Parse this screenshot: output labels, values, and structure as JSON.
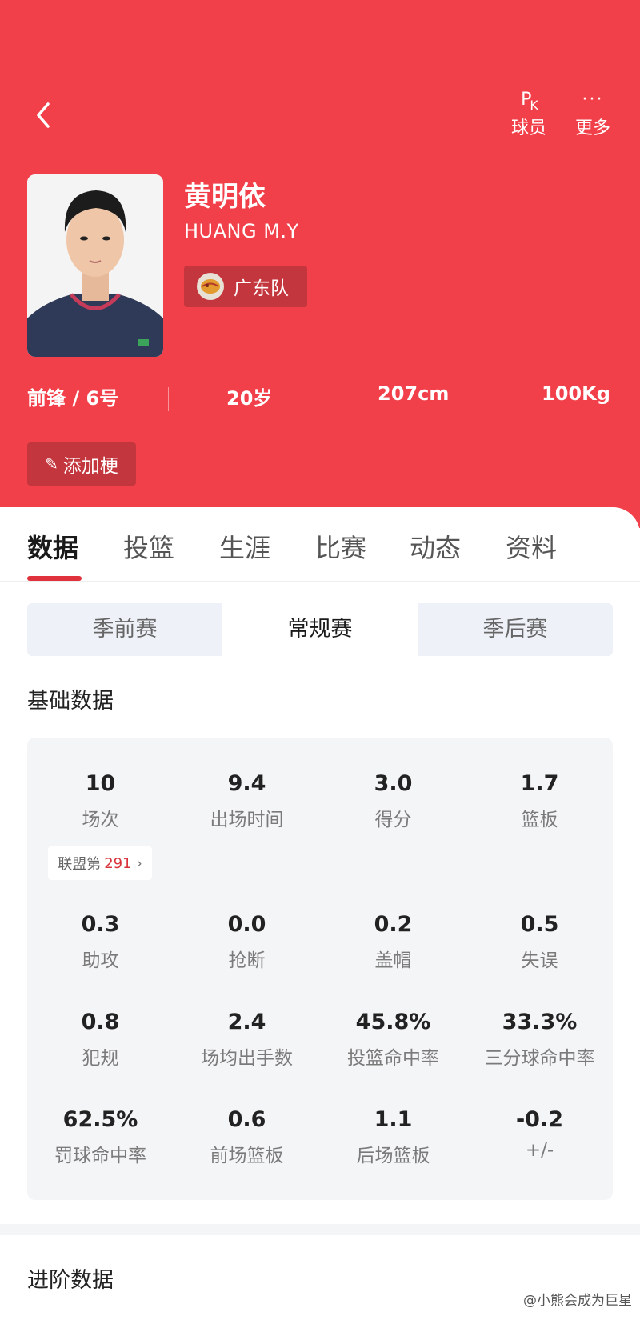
{
  "header": {
    "pk_label": "球员",
    "pk_icon_text": "PK",
    "more_label": "更多",
    "more_icon_text": "···"
  },
  "player": {
    "name_cn": "黄明依",
    "name_en": "HUANG M.Y",
    "team": "广东队",
    "position": "前锋 / 6号",
    "age": "20岁",
    "height": "207cm",
    "weight": "100Kg",
    "add_tag_label": "添加梗"
  },
  "tabs": [
    {
      "label": "数据",
      "active": true
    },
    {
      "label": "投篮",
      "active": false
    },
    {
      "label": "生涯",
      "active": false
    },
    {
      "label": "比赛",
      "active": false
    },
    {
      "label": "动态",
      "active": false
    },
    {
      "label": "资料",
      "active": false
    }
  ],
  "season_types": [
    {
      "label": "季前赛",
      "active": false
    },
    {
      "label": "常规赛",
      "active": true
    },
    {
      "label": "季后赛",
      "active": false
    }
  ],
  "basic_title": "基础数据",
  "basic_stats": [
    {
      "value": "10",
      "label": "场次"
    },
    {
      "value": "9.4",
      "label": "出场时间"
    },
    {
      "value": "3.0",
      "label": "得分"
    },
    {
      "value": "1.7",
      "label": "篮板"
    },
    {
      "value": "0.3",
      "label": "助攻"
    },
    {
      "value": "0.0",
      "label": "抢断"
    },
    {
      "value": "0.2",
      "label": "盖帽"
    },
    {
      "value": "0.5",
      "label": "失误"
    },
    {
      "value": "0.8",
      "label": "犯规"
    },
    {
      "value": "2.4",
      "label": "场均出手数"
    },
    {
      "value": "45.8%",
      "label": "投篮命中率"
    },
    {
      "value": "33.3%",
      "label": "三分球命中率"
    },
    {
      "value": "62.5%",
      "label": "罚球命中率"
    },
    {
      "value": "0.6",
      "label": "前场篮板"
    },
    {
      "value": "1.1",
      "label": "后场篮板"
    },
    {
      "value": "-0.2",
      "label": "+/-"
    }
  ],
  "rank": {
    "prefix": "联盟第",
    "number": "291",
    "chevron": "›"
  },
  "advanced_title": "进阶数据",
  "watermark": "@小熊会成为巨星"
}
